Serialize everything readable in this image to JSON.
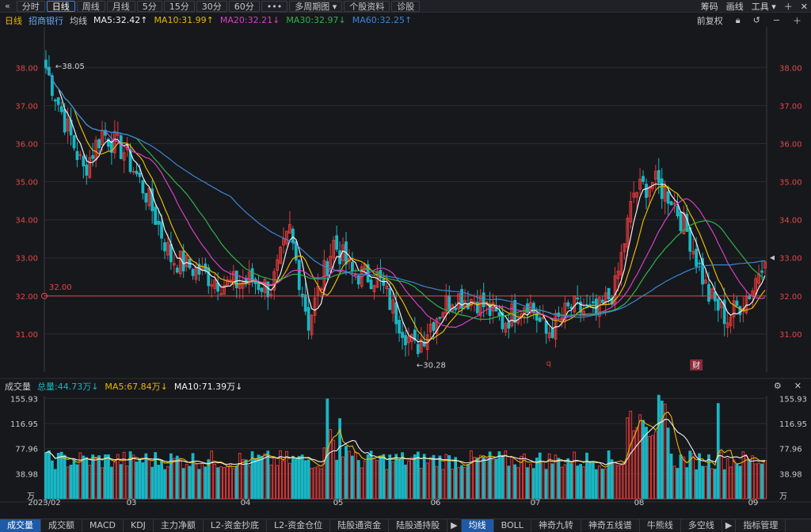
{
  "toolbar": {
    "back_glyph": "«",
    "buttons": [
      "分时",
      "日线",
      "周线",
      "月线",
      "5分",
      "15分",
      "30分",
      "60分",
      "•••",
      "多周期图",
      "个股资料",
      "诊股"
    ],
    "active_index": 1,
    "right": [
      "筹码",
      "画线",
      "工具"
    ],
    "icons": [
      "plus-icon",
      "close-icon"
    ]
  },
  "kline_info": {
    "period": "日线",
    "stock": "招商银行",
    "avg_label": "均线",
    "ma5": "MA5:32.42↑",
    "ma10": "MA10:31.99↑",
    "ma20": "MA20:32.21↓",
    "ma30": "MA30:32.97↓",
    "ma60": "MA60:32.25↑",
    "adjust": "前复权"
  },
  "volume_info": {
    "label": "成交量",
    "total": "总量:44.73万↓",
    "ma5": "MA5:67.84万↓",
    "ma10": "MA10:71.39万↓"
  },
  "colors": {
    "up": "#e03a3a",
    "down": "#19b7c4",
    "ma5": "#f0f0f0",
    "ma10": "#e8b800",
    "ma20": "#d83fc6",
    "ma30": "#2fb34a",
    "ma60": "#3a86d6",
    "ref": "#e04848"
  },
  "price_axis": [
    "38.00",
    "37.00",
    "36.00",
    "35.00",
    "34.00",
    "33.00",
    "32.00",
    "31.00"
  ],
  "volume_axis": [
    "155.93",
    "116.95",
    "77.96",
    "38.98",
    "万"
  ],
  "date_axis": [
    "2023/02",
    "03",
    "04",
    "05",
    "06",
    "07",
    "08",
    "09"
  ],
  "annotations": {
    "high": "38.05",
    "low": "30.28",
    "ref": "32.00",
    "event": "q",
    "fin_badge": "财"
  },
  "bottom_tabs": [
    "成交量",
    "成交额",
    "MACD",
    "KDJ",
    "主力净额",
    "L2-资金抄底",
    "L2-资金仓位",
    "陆股通资金",
    "陆股通持股",
    "▶",
    "均线",
    "BOLL",
    "神奇九转",
    "神奇五线谱",
    "牛熊线",
    "多空线",
    "▶",
    "指标管理"
  ],
  "bottom_active": [
    0,
    10
  ]
}
